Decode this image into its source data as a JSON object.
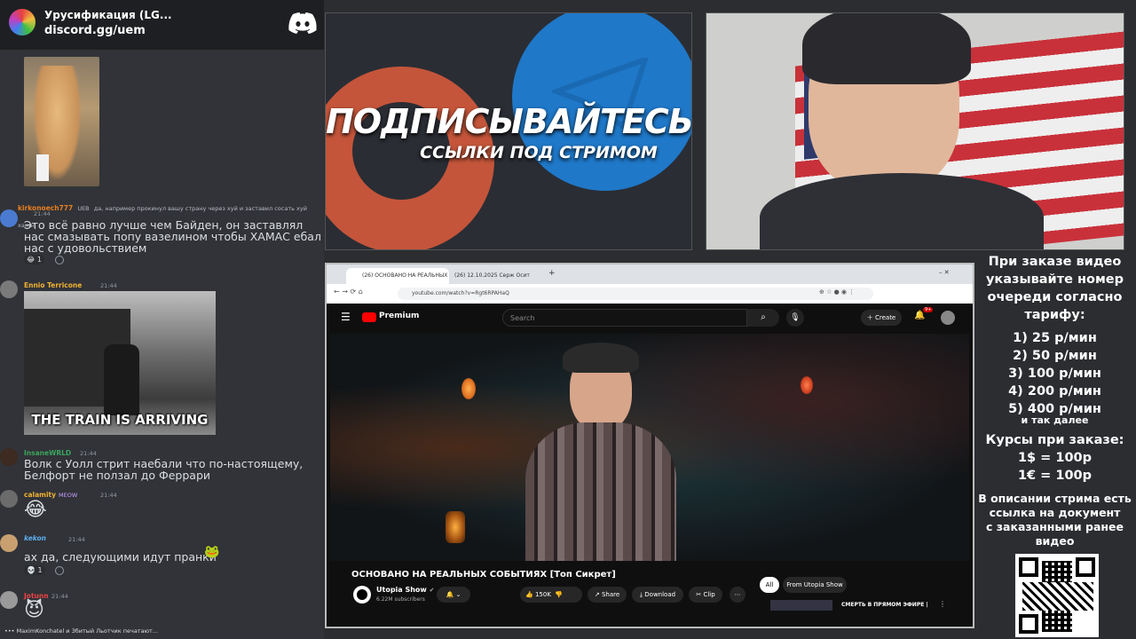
{
  "discord": {
    "server_name": "Урусификация (LG...",
    "invite_link": "discord.gg/uem",
    "messages": [
      {
        "user": "kirkonoech777",
        "tag": "UEB",
        "reply_text": "да, например прокинул вашу страну через хуй и заставил сосать хуй хамас",
        "time": "21:44",
        "text": "Это всё равно лучше чем Байден, он заставлял нас смазывать попу вазелином чтобы ХАМАС ебал нас с удовольствием",
        "reaction_count": "1"
      },
      {
        "user": "Ennio Terricone",
        "time": "21:44",
        "gif_caption": "THE TRAIN IS ARRIVING"
      },
      {
        "user": "InsaneWRLD",
        "time": "21:44",
        "text": "Волк с Уолл стрит наебали что по-настоящему, Белфорт не ползал до Феррари"
      },
      {
        "user": "calamity",
        "tag": "MEOW",
        "time": "21:44",
        "emoji": "😂"
      },
      {
        "user": "kekon",
        "time": "21:44",
        "text": "ах да, следующими идут пранки",
        "reaction_count": "1"
      },
      {
        "user": "Jotunn",
        "time": "21:44",
        "emoji": "😈"
      }
    ],
    "typing": "MaximKonchatel и Збитый Льотчик печатают..."
  },
  "promo": {
    "title": "ПОДПИСЫВАЙТЕСЬ",
    "subtitle": "ССЫЛКИ ПОД СТРИМОМ"
  },
  "info": {
    "intro": [
      "При заказе видео",
      "указывайте номер",
      "очереди согласно",
      "тарифу:"
    ],
    "tariffs": [
      "1) 25 р/мин",
      "2) 50 р/мин",
      "3) 100 р/мин",
      "4) 200 р/мин",
      "5) 400 р/мин"
    ],
    "etc": "и так далее",
    "rates_title": "Курсы при заказе:",
    "rates": [
      "1$ = 100р",
      "1€ = 100р"
    ],
    "desc": [
      "В описании стрима есть",
      "ссылка на документ",
      "с заказанными ранее",
      "видео"
    ]
  },
  "browser": {
    "tabs": [
      "(26) ОСНОВАНО НА РЕАЛЬНЫХ",
      "(26) 12.10.2025 Серж Осит"
    ],
    "url": "youtube.com/watch?v=Rgt6RPAHaQ",
    "yt_logo": "Premium",
    "search_placeholder": "Search",
    "create_label": "Create",
    "notif_count": "9+",
    "video_title": "ОСНОВАНО НА РЕАЛЬНЫХ СОБЫТИЯХ [Топ Сикрет]",
    "channel": "Utopia Show",
    "subscribers": "6.22M subscribers",
    "likes": "150K",
    "share": "Share",
    "download": "Download",
    "clip": "Clip",
    "chip_all": "All",
    "chip_from": "From Utopia Show",
    "rec_title": "СМЕРТЬ В ПРЯМОМ ЭФИРЕ |"
  }
}
